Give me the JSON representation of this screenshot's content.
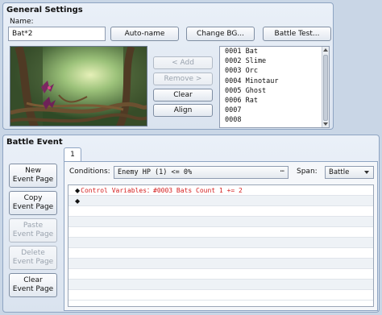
{
  "general_settings": {
    "title": "General Settings",
    "name_label": "Name:",
    "name_value": "Bat*2",
    "auto_name": "Auto-name",
    "change_bg": "Change BG...",
    "battle_test": "Battle Test...",
    "add": "< Add",
    "remove": "Remove >",
    "clear": "Clear",
    "align": "Align",
    "enemy_list": [
      "0001 Bat",
      "0002 Slime",
      "0003 Orc",
      "0004 Minotaur",
      "0005 Ghost",
      "0006 Rat",
      "0007",
      "0008"
    ]
  },
  "battle_event": {
    "title": "Battle Event",
    "tab": "1",
    "new_page": "New\nEvent Page",
    "copy_page": "Copy\nEvent Page",
    "paste_page": "Paste\nEvent Page",
    "delete_page": "Delete\nEvent Page",
    "clear_page": "Clear\nEvent Page",
    "conditions_label": "Conditions:",
    "conditions_value": "Enemy HP (1) <= 0%",
    "span_label": "Span:",
    "span_value": "Battle",
    "commands": [
      {
        "marker": "◆",
        "text": "Control Variables：#0003 Bats Count 1 += 2"
      },
      {
        "marker": "◆",
        "text": ""
      }
    ]
  },
  "colors": {
    "accent": "#dae3ef",
    "command_text": "#d42020"
  }
}
